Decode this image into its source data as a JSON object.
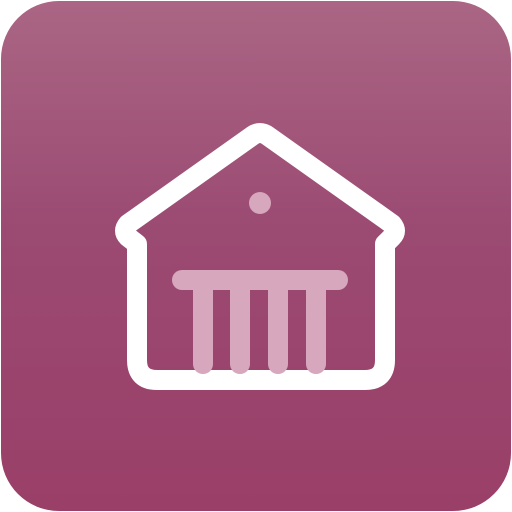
{
  "app_icon": {
    "icon_name": "house-with-columns-icon",
    "colors": {
      "tile_top": "#aa6684",
      "tile_mid": "#9b4a72",
      "tile_bottom": "#9a3f68",
      "outline": "#ffffff",
      "columns": "#d6a7bd"
    }
  }
}
